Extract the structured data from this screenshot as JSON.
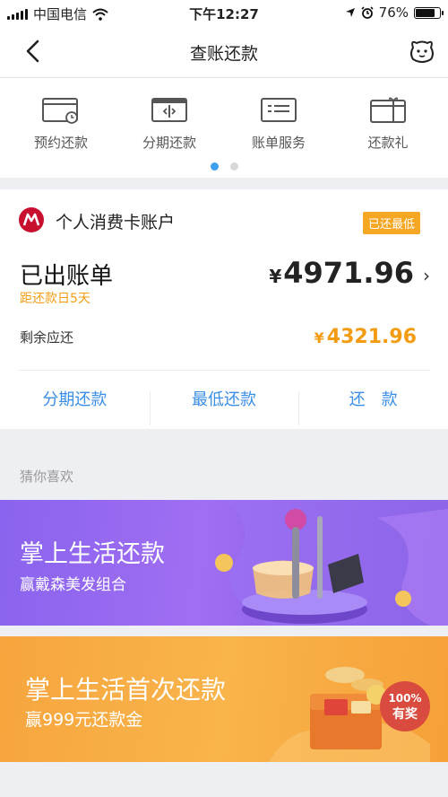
{
  "status_bar": {
    "carrier": "中国电信",
    "time": "下午12:27",
    "battery": "76%"
  },
  "nav": {
    "title": "查账还款"
  },
  "services": [
    {
      "label": "预约还款",
      "icon": "card-clock-icon"
    },
    {
      "label": "分期还款",
      "icon": "card-split-icon"
    },
    {
      "label": "账单服务",
      "icon": "bill-card-icon"
    },
    {
      "label": "还款礼",
      "icon": "gift-card-icon"
    }
  ],
  "pager": {
    "total": 2,
    "active": 1
  },
  "account": {
    "name": "个人消费卡账户",
    "badge": "已还最低",
    "bill_title": "已出账单",
    "due_text": "距还款日5天",
    "currency": "¥",
    "amount": "4971.96",
    "remaining_label": "剩余应还",
    "remaining": "4321.96",
    "actions": [
      "分期还款",
      "最低还款",
      "还　款"
    ]
  },
  "recommend": {
    "header": "猜你喜欢",
    "banner1": {
      "title": "掌上生活还款",
      "subtitle": "赢戴森美发组合"
    },
    "banner2": {
      "title": "掌上生活首次还款",
      "subtitle": "赢999元还款金",
      "award_percent": "100%",
      "award_text": "有奖"
    }
  },
  "colors": {
    "accent_blue": "#3a8ee6",
    "orange": "#f39c12",
    "brand_red": "#c8102e",
    "purple": "#8a63ee"
  }
}
